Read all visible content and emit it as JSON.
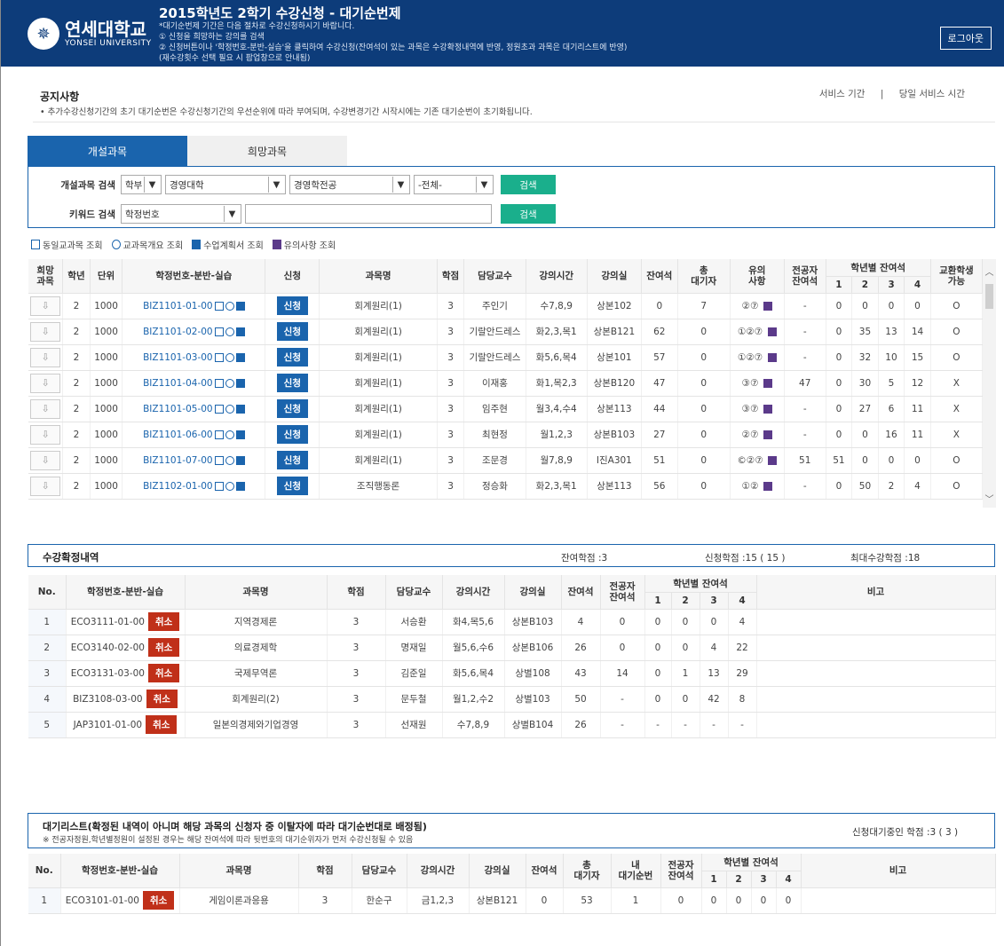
{
  "header": {
    "logo_kr": "연세대학교",
    "logo_en": "YONSEI UNIVERSITY",
    "title": "2015학년도 2학기 수강신청 - 대기순번제",
    "notes": [
      "*대기순번제 기간은 다음 절차로 수강신청하시기 바랍니다.",
      "① 신청을 희망하는 강의를 검색",
      "② 신청버튼이나 '학정번호-분반-실습'을 클릭하여 수강신청(잔여석이 있는 과목은 수강확정내역에 반영, 정원초과 과목은 대기리스트에 반영)",
      "(재수강횟수 선택 필요 시 팝업창으로 안내됨)"
    ],
    "logout_label": "로그아웃"
  },
  "notice": {
    "title": "공지사항",
    "text": "• 추가수강신청기간의 초기 대기순번은 수강신청기간의 우선순위에 따라 부여되며, 수강변경기간 시작시에는 기존 대기순번이 초기화됩니다.",
    "link_service": "서비스 기간",
    "divider": "|",
    "link_today": "당일 서비스 시간"
  },
  "tabs": {
    "open": "개설과목",
    "wish": "희망과목"
  },
  "search": {
    "row1_label": "개설과목 검색",
    "category": "학부",
    "college": "경영대학",
    "major": "경영학전공",
    "filter": "-전체-",
    "search_btn": "검색",
    "row2_label": "키워드 검색",
    "keyword_type": "학정번호",
    "keyword_value": "",
    "search_btn2": "검색"
  },
  "legend": {
    "same": "동일교과목 조회",
    "outline": "교과목개요 조회",
    "plan": "수업계획서 조회",
    "caution": "유의사항 조회"
  },
  "course_table": {
    "headers": {
      "wish": "희망\n과목",
      "year": "학년",
      "unit": "단위",
      "code": "학정번호-분반-실습",
      "apply": "신청",
      "name": "과목명",
      "credit": "학점",
      "prof": "담당교수",
      "time": "강의시간",
      "room": "강의실",
      "remain": "잔여석",
      "waiting": "총\n대기자",
      "caution": "유의\n사항",
      "major_remain": "전공자\n잔여석",
      "by_year": "학년별 잔여석",
      "y1": "1",
      "y2": "2",
      "y3": "3",
      "y4": "4",
      "exchange": "교환학생\n가능"
    },
    "apply_label": "신청",
    "rows": [
      {
        "year": "2",
        "unit": "1000",
        "code": "BIZ1101-01-00",
        "name": "회계원리(1)",
        "credit": "3",
        "prof": "주인기",
        "time": "수7,8,9",
        "room": "상본102",
        "remain": "0",
        "waiting": "7",
        "caution": "②⑦",
        "major": "-",
        "y1": "0",
        "y2": "0",
        "y3": "0",
        "y4": "0",
        "ex": "O"
      },
      {
        "year": "2",
        "unit": "1000",
        "code": "BIZ1101-02-00",
        "name": "회계원리(1)",
        "credit": "3",
        "prof": "기랄안드레스",
        "time": "화2,3,목1",
        "room": "상본B121",
        "remain": "62",
        "waiting": "0",
        "caution": "①②⑦",
        "major": "-",
        "y1": "0",
        "y2": "35",
        "y3": "13",
        "y4": "14",
        "ex": "O"
      },
      {
        "year": "2",
        "unit": "1000",
        "code": "BIZ1101-03-00",
        "name": "회계원리(1)",
        "credit": "3",
        "prof": "기랄안드레스",
        "time": "화5,6,목4",
        "room": "상본101",
        "remain": "57",
        "waiting": "0",
        "caution": "①②⑦",
        "major": "-",
        "y1": "0",
        "y2": "32",
        "y3": "10",
        "y4": "15",
        "ex": "O"
      },
      {
        "year": "2",
        "unit": "1000",
        "code": "BIZ1101-04-00",
        "name": "회계원리(1)",
        "credit": "3",
        "prof": "이재홍",
        "time": "화1,목2,3",
        "room": "상본B120",
        "remain": "47",
        "waiting": "0",
        "caution": "③⑦",
        "major": "47",
        "y1": "0",
        "y2": "30",
        "y3": "5",
        "y4": "12",
        "ex": "X"
      },
      {
        "year": "2",
        "unit": "1000",
        "code": "BIZ1101-05-00",
        "name": "회계원리(1)",
        "credit": "3",
        "prof": "임주현",
        "time": "월3,4,수4",
        "room": "상본113",
        "remain": "44",
        "waiting": "0",
        "caution": "③⑦",
        "major": "-",
        "y1": "0",
        "y2": "27",
        "y3": "6",
        "y4": "11",
        "ex": "X"
      },
      {
        "year": "2",
        "unit": "1000",
        "code": "BIZ1101-06-00",
        "name": "회계원리(1)",
        "credit": "3",
        "prof": "최현정",
        "time": "월1,2,3",
        "room": "상본B103",
        "remain": "27",
        "waiting": "0",
        "caution": "②⑦",
        "major": "-",
        "y1": "0",
        "y2": "0",
        "y3": "16",
        "y4": "11",
        "ex": "X"
      },
      {
        "year": "2",
        "unit": "1000",
        "code": "BIZ1101-07-00",
        "name": "회계원리(1)",
        "credit": "3",
        "prof": "조문경",
        "time": "월7,8,9",
        "room": "I진A301",
        "remain": "51",
        "waiting": "0",
        "caution": "©②⑦",
        "major": "51",
        "y1": "51",
        "y2": "0",
        "y3": "0",
        "y4": "0",
        "ex": "O"
      },
      {
        "year": "2",
        "unit": "1000",
        "code": "BIZ1102-01-00",
        "name": "조직행동론",
        "credit": "3",
        "prof": "정승화",
        "time": "화2,3,목1",
        "room": "상본113",
        "remain": "56",
        "waiting": "0",
        "caution": "①②",
        "major": "-",
        "y1": "0",
        "y2": "50",
        "y3": "2",
        "y4": "4",
        "ex": "O"
      }
    ]
  },
  "confirmed": {
    "title": "수강확정내역",
    "remain_credit": "잔여학점 :3",
    "applied_credit": "신청학점 :15 ( 15 )",
    "max_credit": "최대수강학점 :18",
    "headers": {
      "no": "No.",
      "code": "학정번호-분반-실습",
      "name": "과목명",
      "credit": "학점",
      "prof": "담당교수",
      "time": "강의시간",
      "room": "강의실",
      "remain": "잔여석",
      "major": "전공자\n잔여석",
      "by_year": "학년별 잔여석",
      "y1": "1",
      "y2": "2",
      "y3": "3",
      "y4": "4",
      "note": "비고"
    },
    "cancel_label": "취소",
    "rows": [
      {
        "no": "1",
        "code": "ECO3111-01-00",
        "name": "지역경제론",
        "credit": "3",
        "prof": "서승환",
        "time": "화4,목5,6",
        "room": "상본B103",
        "remain": "4",
        "major": "0",
        "y1": "0",
        "y2": "0",
        "y3": "0",
        "y4": "4"
      },
      {
        "no": "2",
        "code": "ECO3140-02-00",
        "name": "의료경제학",
        "credit": "3",
        "prof": "명재일",
        "time": "월5,6,수6",
        "room": "상본B106",
        "remain": "26",
        "major": "0",
        "y1": "0",
        "y2": "0",
        "y3": "4",
        "y4": "22"
      },
      {
        "no": "3",
        "code": "ECO3131-03-00",
        "name": "국제무역론",
        "credit": "3",
        "prof": "김준일",
        "time": "화5,6,목4",
        "room": "상별108",
        "remain": "43",
        "major": "14",
        "y1": "0",
        "y2": "1",
        "y3": "13",
        "y4": "29"
      },
      {
        "no": "4",
        "code": "BIZ3108-03-00",
        "name": "회계원리(2)",
        "credit": "3",
        "prof": "문두철",
        "time": "월1,2,수2",
        "room": "상별103",
        "remain": "50",
        "major": "-",
        "y1": "0",
        "y2": "0",
        "y3": "42",
        "y4": "8"
      },
      {
        "no": "5",
        "code": "JAP3101-01-00",
        "name": "일본의경제와기업경영",
        "credit": "3",
        "prof": "선재원",
        "time": "수7,8,9",
        "room": "상별B104",
        "remain": "26",
        "major": "-",
        "y1": "-",
        "y2": "-",
        "y3": "-",
        "y4": "-"
      }
    ]
  },
  "waitlist": {
    "title": "대기리스트(확정된 내역이 아니며 해당 과목의 신청자 중 이탈자에 따라 대기순번대로 배정됨)",
    "subtitle": "※ 전공자정원,학년별정원이 설정된 경우는 해당 잔여석에 따라 뒷번호의 대기순위자가 먼저 수강신청될 수 있음",
    "waiting_credit": "신청대기중인 학점 :3 ( 3 )",
    "headers": {
      "no": "No.",
      "code": "학정번호-분반-실습",
      "name": "과목명",
      "credit": "학점",
      "prof": "담당교수",
      "time": "강의시간",
      "room": "강의실",
      "remain": "잔여석",
      "waiting": "총\n대기자",
      "my": "내\n대기순번",
      "major": "전공자\n잔여석",
      "by_year": "학년별 잔여석",
      "y1": "1",
      "y2": "2",
      "y3": "3",
      "y4": "4",
      "note": "비고"
    },
    "cancel_label": "취소",
    "rows": [
      {
        "no": "1",
        "code": "ECO3101-01-00",
        "name": "게임이론과응용",
        "credit": "3",
        "prof": "한순구",
        "time": "금1,2,3",
        "room": "상본B121",
        "remain": "0",
        "waiting": "53",
        "my": "1",
        "major": "0",
        "y1": "0",
        "y2": "0",
        "y3": "0",
        "y4": "0"
      }
    ]
  },
  "colors": {
    "header_bg": "#0d3c7a",
    "tab_active": "#1a64ad",
    "apply_btn": "#1a64ad",
    "cancel_btn": "#c03019",
    "search_btn": "#1aaf8c"
  }
}
